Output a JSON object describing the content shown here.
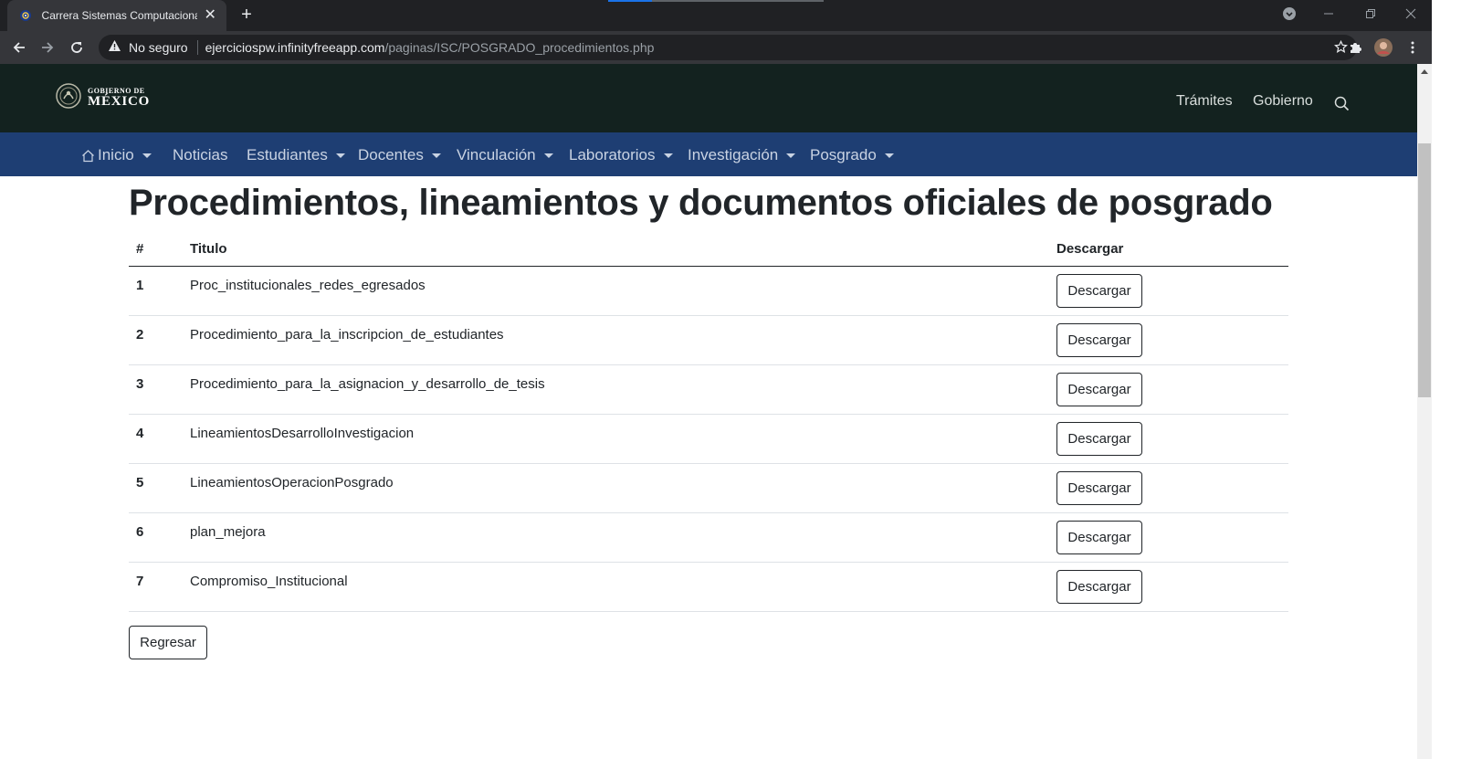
{
  "browser": {
    "tab_title": "Carrera Sistemas Computacionales",
    "security_label": "No seguro",
    "url_host": "ejerciciospw.infinityfreeapp.com",
    "url_path": "/paginas/ISC/POSGRADO_procedimientos.php"
  },
  "gov_header": {
    "logo_line1": "GOBIERNO DE",
    "logo_line2": "MÉXICO",
    "links": [
      "Trámites",
      "Gobierno"
    ]
  },
  "navbar": {
    "items": [
      {
        "label": "Inicio",
        "dropdown": true
      },
      {
        "label": "Noticias",
        "dropdown": false
      },
      {
        "label": "Estudiantes",
        "dropdown": true
      },
      {
        "label": "Docentes",
        "dropdown": true
      },
      {
        "label": "Vinculación",
        "dropdown": true
      },
      {
        "label": "Laboratorios",
        "dropdown": true
      },
      {
        "label": "Investigación",
        "dropdown": true
      },
      {
        "label": "Posgrado",
        "dropdown": true
      }
    ]
  },
  "main": {
    "title": "Procedimientos, lineamientos y documentos oficiales de posgrado",
    "table": {
      "headers": [
        "#",
        "Titulo",
        "Descargar"
      ],
      "rows": [
        {
          "num": "1",
          "title": "Proc_institucionales_redes_egresados",
          "action": "Descargar"
        },
        {
          "num": "2",
          "title": "Procedimiento_para_la_inscripcion_de_estudiantes",
          "action": "Descargar"
        },
        {
          "num": "3",
          "title": "Procedimiento_para_la_asignacion_y_desarrollo_de_tesis",
          "action": "Descargar"
        },
        {
          "num": "4",
          "title": "LineamientosDesarrolloInvestigacion",
          "action": "Descargar"
        },
        {
          "num": "5",
          "title": "LineamientosOperacionPosgrado",
          "action": "Descargar"
        },
        {
          "num": "6",
          "title": "plan_mejora",
          "action": "Descargar"
        },
        {
          "num": "7",
          "title": "Compromiso_Institucional",
          "action": "Descargar"
        }
      ]
    },
    "back_label": "Regresar"
  },
  "colors": {
    "gov_dark": "#13221f",
    "nav_blue": "#1e3e73",
    "text": "#212529"
  }
}
